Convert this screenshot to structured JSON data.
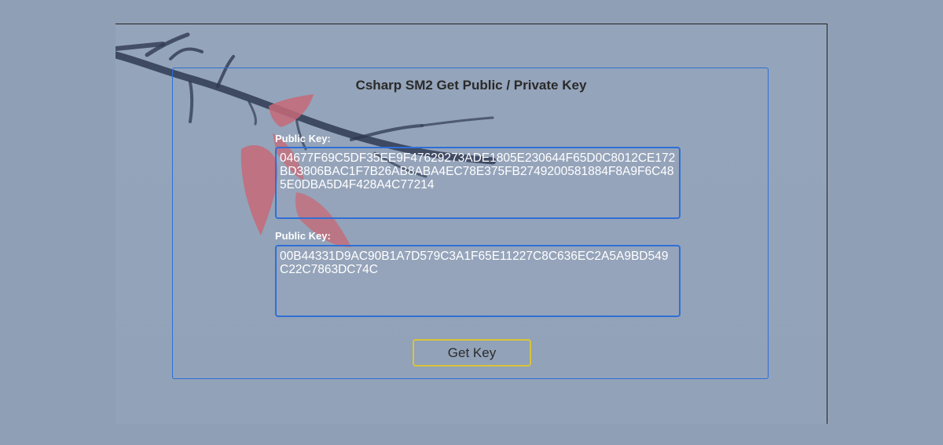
{
  "panel": {
    "title": "Csharp SM2 Get Public / Private Key"
  },
  "public_key": {
    "label": "Public Key:",
    "value": "04677F69C5DF35EE9F47629273ADE1805E230644F65D0C8012CE172BD3806BAC1F7B26AB8ABA4EC78E375FB2749200581884F8A9F6C485E0DBA5D4F428A4C77214"
  },
  "private_key": {
    "label": "Public Key:",
    "value": "00B44331D9AC90B1A7D579C3A1F65E11227C8C636EC2A5A9BD549C22C7863DC74C"
  },
  "actions": {
    "get_key_label": "Get Key"
  },
  "colors": {
    "background": "#8f9fb5",
    "panel_border": "#2f6fd6",
    "button_border": "#d8c43a",
    "text_white": "#ffffff",
    "branch_ink": "#2f3a52",
    "leaf_red": "#c56a78"
  },
  "icons": {
    "background_art": "branch-with-red-leaves"
  }
}
